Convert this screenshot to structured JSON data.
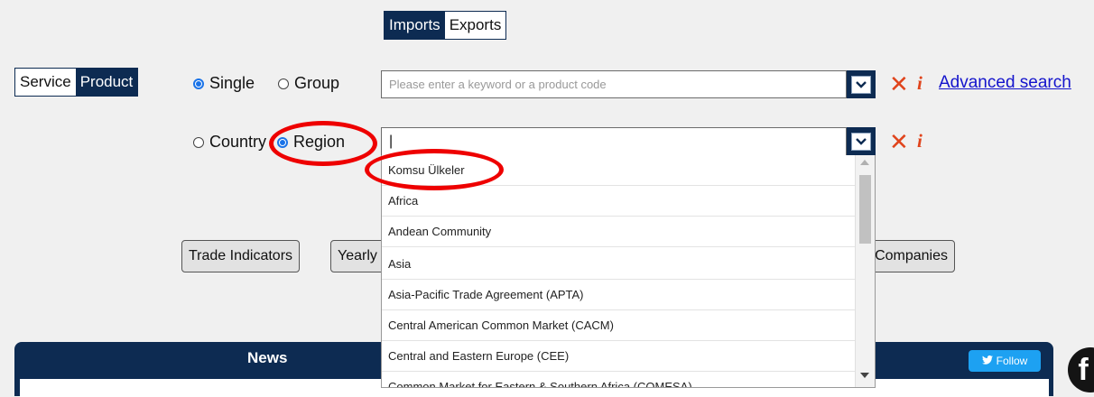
{
  "trade_toggle": {
    "imports": "Imports",
    "exports": "Exports"
  },
  "type_toggle": {
    "service": "Service",
    "product": "Product"
  },
  "product_mode": {
    "single": "Single",
    "group": "Group"
  },
  "search": {
    "placeholder": "Please enter a keyword or a product code"
  },
  "advanced_search": "Advanced search",
  "partner_mode": {
    "country": "Country",
    "region": "Region"
  },
  "region_input": {
    "value": "|"
  },
  "region_options": [
    "Komsu Ülkeler",
    "Africa",
    "Andean Community",
    "Asia",
    "Asia-Pacific Trade Agreement (APTA)",
    "Central American Common Market (CACM)",
    "Central and Eastern Europe (CEE)",
    "Common Market for Eastern & Southern Africa (COMESA)"
  ],
  "buttons": {
    "trade_indicators": "Trade Indicators",
    "yearly": "Yearly",
    "companies": "Companies"
  },
  "news": {
    "title": "News",
    "follow": "Follow"
  },
  "icons": {
    "clear": "close-icon",
    "info": "info-icon",
    "dropdown": "chevron-down-icon",
    "twitter": "twitter-icon",
    "facebook": "facebook-icon"
  },
  "colors": {
    "navy": "#0d2b52",
    "accent_red": "#e0441c",
    "link_blue": "#1414cc",
    "radio_blue": "#1a73e8",
    "twitter": "#1da1f2"
  }
}
